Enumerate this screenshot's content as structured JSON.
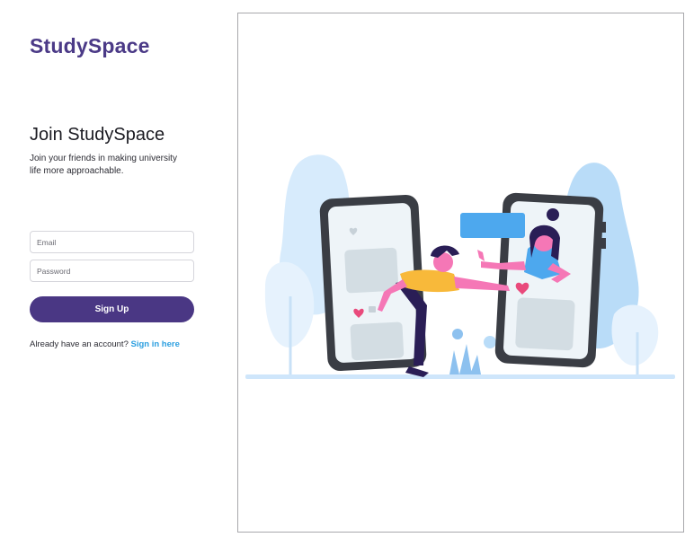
{
  "brand": {
    "name": "StudySpace"
  },
  "signup": {
    "heading": "Join StudySpace",
    "subtitle": "Join your friends in making university life more approachable.",
    "email_placeholder": "Email",
    "password_placeholder": "Password",
    "submit_label": "Sign Up",
    "account_prompt": "Already have an account?",
    "signin_link": "Sign in here"
  },
  "illustration": {
    "name": "two-people-reaching-through-phones-illustration",
    "colors": {
      "brand": "#4b3a87",
      "button": "#4a3784",
      "link": "#2c9fe0",
      "light_blue": "#cfe6fb",
      "mid_blue": "#a9d1f5",
      "accent_blue": "#4da8ee",
      "phone_dark": "#3a3d44",
      "shirt_yellow": "#f8b93a",
      "skin_pink": "#f577b6",
      "heart": "#e94a7c",
      "hair": "#2a1e56"
    }
  }
}
